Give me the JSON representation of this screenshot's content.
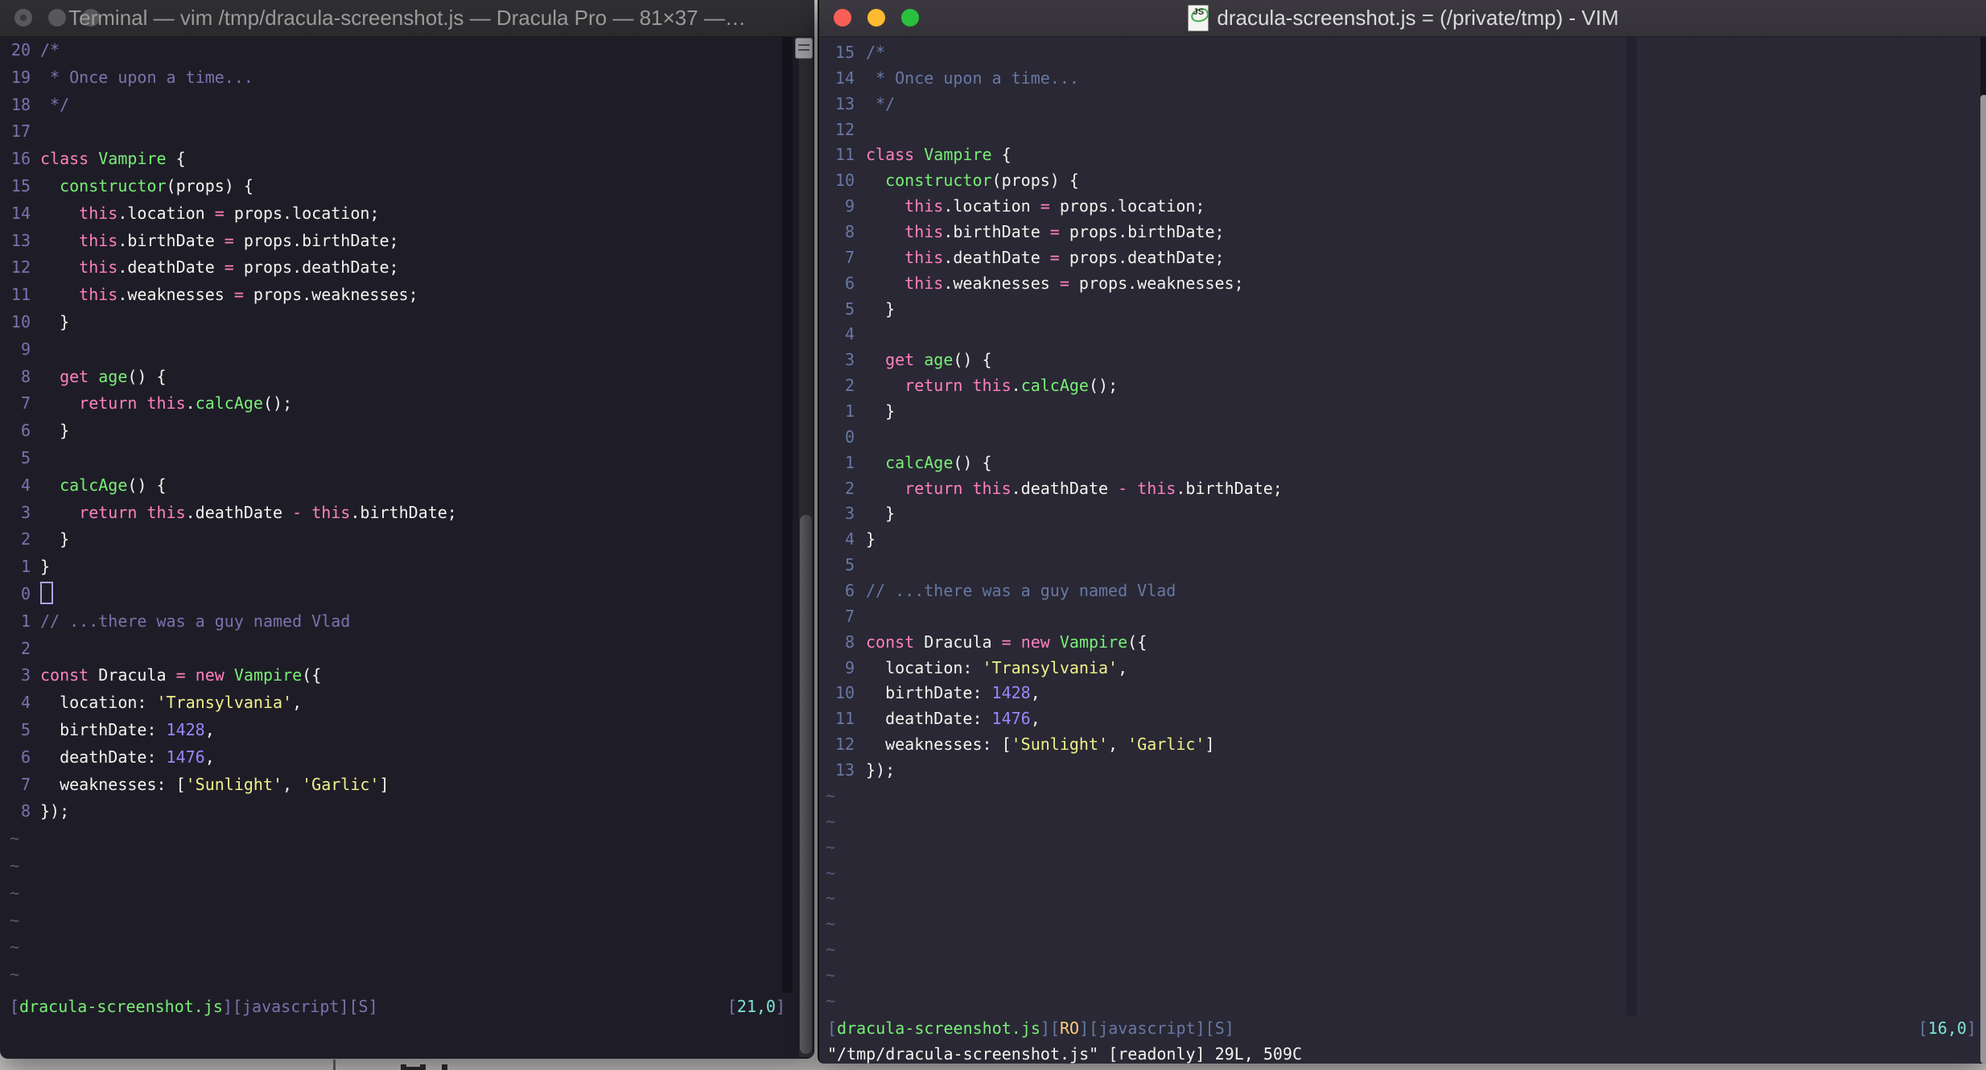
{
  "colors": {
    "left_bg": "#1e1d27",
    "right_bg": "#292834",
    "foreground": "#f4f3ee",
    "pink": "#ff80bf",
    "green": "#79ee77",
    "yellow": "#f0f18b",
    "purple": "#9a86fb",
    "cyan": "#7fe3dc",
    "orange": "#ffca80",
    "left_comment": "#7b72ae",
    "right_comment": "#6878a4",
    "light_red": "#f95f57",
    "light_yellow": "#febb2f",
    "light_green": "#2ac03f"
  },
  "code_lines": [
    [
      [
        "c",
        "/*"
      ]
    ],
    [
      [
        "c",
        " * Once upon a time..."
      ]
    ],
    [
      [
        "c",
        " */"
      ]
    ],
    [],
    [
      [
        "p",
        "class"
      ],
      [
        "f",
        " "
      ],
      [
        "g",
        "Vampire"
      ],
      [
        "f",
        " {"
      ]
    ],
    [
      [
        "f",
        "  "
      ],
      [
        "g",
        "constructor"
      ],
      [
        "f",
        "(props) {"
      ]
    ],
    [
      [
        "f",
        "    "
      ],
      [
        "p",
        "this"
      ],
      [
        "f",
        ".location "
      ],
      [
        "p",
        "="
      ],
      [
        "f",
        " props.location;"
      ]
    ],
    [
      [
        "f",
        "    "
      ],
      [
        "p",
        "this"
      ],
      [
        "f",
        ".birthDate "
      ],
      [
        "p",
        "="
      ],
      [
        "f",
        " props.birthDate;"
      ]
    ],
    [
      [
        "f",
        "    "
      ],
      [
        "p",
        "this"
      ],
      [
        "f",
        ".deathDate "
      ],
      [
        "p",
        "="
      ],
      [
        "f",
        " props.deathDate;"
      ]
    ],
    [
      [
        "f",
        "    "
      ],
      [
        "p",
        "this"
      ],
      [
        "f",
        ".weaknesses "
      ],
      [
        "p",
        "="
      ],
      [
        "f",
        " props.weaknesses;"
      ]
    ],
    [
      [
        "f",
        "  }"
      ]
    ],
    [],
    [
      [
        "f",
        "  "
      ],
      [
        "p",
        "get"
      ],
      [
        "f",
        " "
      ],
      [
        "g",
        "age"
      ],
      [
        "f",
        "() {"
      ]
    ],
    [
      [
        "f",
        "    "
      ],
      [
        "p",
        "return"
      ],
      [
        "f",
        " "
      ],
      [
        "p",
        "this"
      ],
      [
        "f",
        "."
      ],
      [
        "g",
        "calcAge"
      ],
      [
        "f",
        "();"
      ]
    ],
    [
      [
        "f",
        "  }"
      ]
    ],
    [],
    [
      [
        "f",
        "  "
      ],
      [
        "g",
        "calcAge"
      ],
      [
        "f",
        "() {"
      ]
    ],
    [
      [
        "f",
        "    "
      ],
      [
        "p",
        "return"
      ],
      [
        "f",
        " "
      ],
      [
        "p",
        "this"
      ],
      [
        "f",
        ".deathDate "
      ],
      [
        "p",
        "-"
      ],
      [
        "f",
        " "
      ],
      [
        "p",
        "this"
      ],
      [
        "f",
        ".birthDate;"
      ]
    ],
    [
      [
        "f",
        "  }"
      ]
    ],
    [
      [
        "f",
        "}"
      ]
    ],
    [],
    [
      [
        "c",
        "// ...there was a guy named Vlad"
      ]
    ],
    [],
    [
      [
        "p",
        "const"
      ],
      [
        "f",
        " Dracula "
      ],
      [
        "p",
        "="
      ],
      [
        "f",
        " "
      ],
      [
        "p",
        "new"
      ],
      [
        "f",
        " "
      ],
      [
        "g",
        "Vampire"
      ],
      [
        "f",
        "({"
      ]
    ],
    [
      [
        "f",
        "  location: "
      ],
      [
        "y",
        "'Transylvania'"
      ],
      [
        "f",
        ","
      ]
    ],
    [
      [
        "f",
        "  birthDate: "
      ],
      [
        "u",
        "1428"
      ],
      [
        "f",
        ","
      ]
    ],
    [
      [
        "f",
        "  deathDate: "
      ],
      [
        "u",
        "1476"
      ],
      [
        "f",
        ","
      ]
    ],
    [
      [
        "f",
        "  weaknesses: ["
      ],
      [
        "y",
        "'Sunlight'"
      ],
      [
        "f",
        ", "
      ],
      [
        "y",
        "'Garlic'"
      ],
      [
        "f",
        "]"
      ]
    ],
    [
      [
        "f",
        "});"
      ]
    ]
  ],
  "left_window": {
    "title": "Terminal — vim /tmp/dracula-screenshot.js — Dracula Pro — 81×37 —…",
    "relnums": [
      20,
      19,
      18,
      17,
      16,
      15,
      14,
      13,
      12,
      11,
      10,
      9,
      8,
      7,
      6,
      5,
      4,
      3,
      2,
      1,
      0,
      1,
      2,
      3,
      4,
      5,
      6,
      7,
      8
    ],
    "cursor_line_index": 20,
    "tilde_rows": 6,
    "tilde_char": "~",
    "status_left": [
      [
        "c",
        "["
      ],
      [
        "g",
        "dracula-screenshot.js"
      ],
      [
        "c",
        "]["
      ],
      [
        "c",
        "javascript"
      ],
      [
        "c",
        "]["
      ],
      [
        "c",
        "S"
      ],
      [
        "c",
        "]"
      ]
    ],
    "status_right": [
      [
        "c",
        "["
      ],
      [
        "t",
        "21,0"
      ],
      [
        "c",
        "]"
      ]
    ]
  },
  "right_window": {
    "title": "dracula-screenshot.js = (/private/tmp) - VIM",
    "doc_icon_label": "JS",
    "relnums": [
      15,
      14,
      13,
      12,
      11,
      10,
      9,
      8,
      7,
      6,
      5,
      4,
      3,
      2,
      1,
      0,
      1,
      2,
      3,
      4,
      5,
      6,
      7,
      8,
      9,
      10,
      11,
      12,
      13
    ],
    "cursor_line_index": 15,
    "tilde_rows": 9,
    "tilde_char": "~",
    "status_left": [
      [
        "c",
        "["
      ],
      [
        "g",
        "dracula-screenshot.js"
      ],
      [
        "c",
        "]["
      ],
      [
        "o",
        "RO"
      ],
      [
        "c",
        "]["
      ],
      [
        "c",
        "javascript"
      ],
      [
        "c",
        "]["
      ],
      [
        "c",
        "S"
      ],
      [
        "c",
        "]"
      ]
    ],
    "status_right": [
      [
        "c",
        "["
      ],
      [
        "t",
        "16,0"
      ],
      [
        "c",
        "]"
      ]
    ],
    "command_line": [
      [
        "f",
        "\"/tmp/dracula-screenshot.js\" [readonly] 29L, 509C"
      ]
    ]
  }
}
